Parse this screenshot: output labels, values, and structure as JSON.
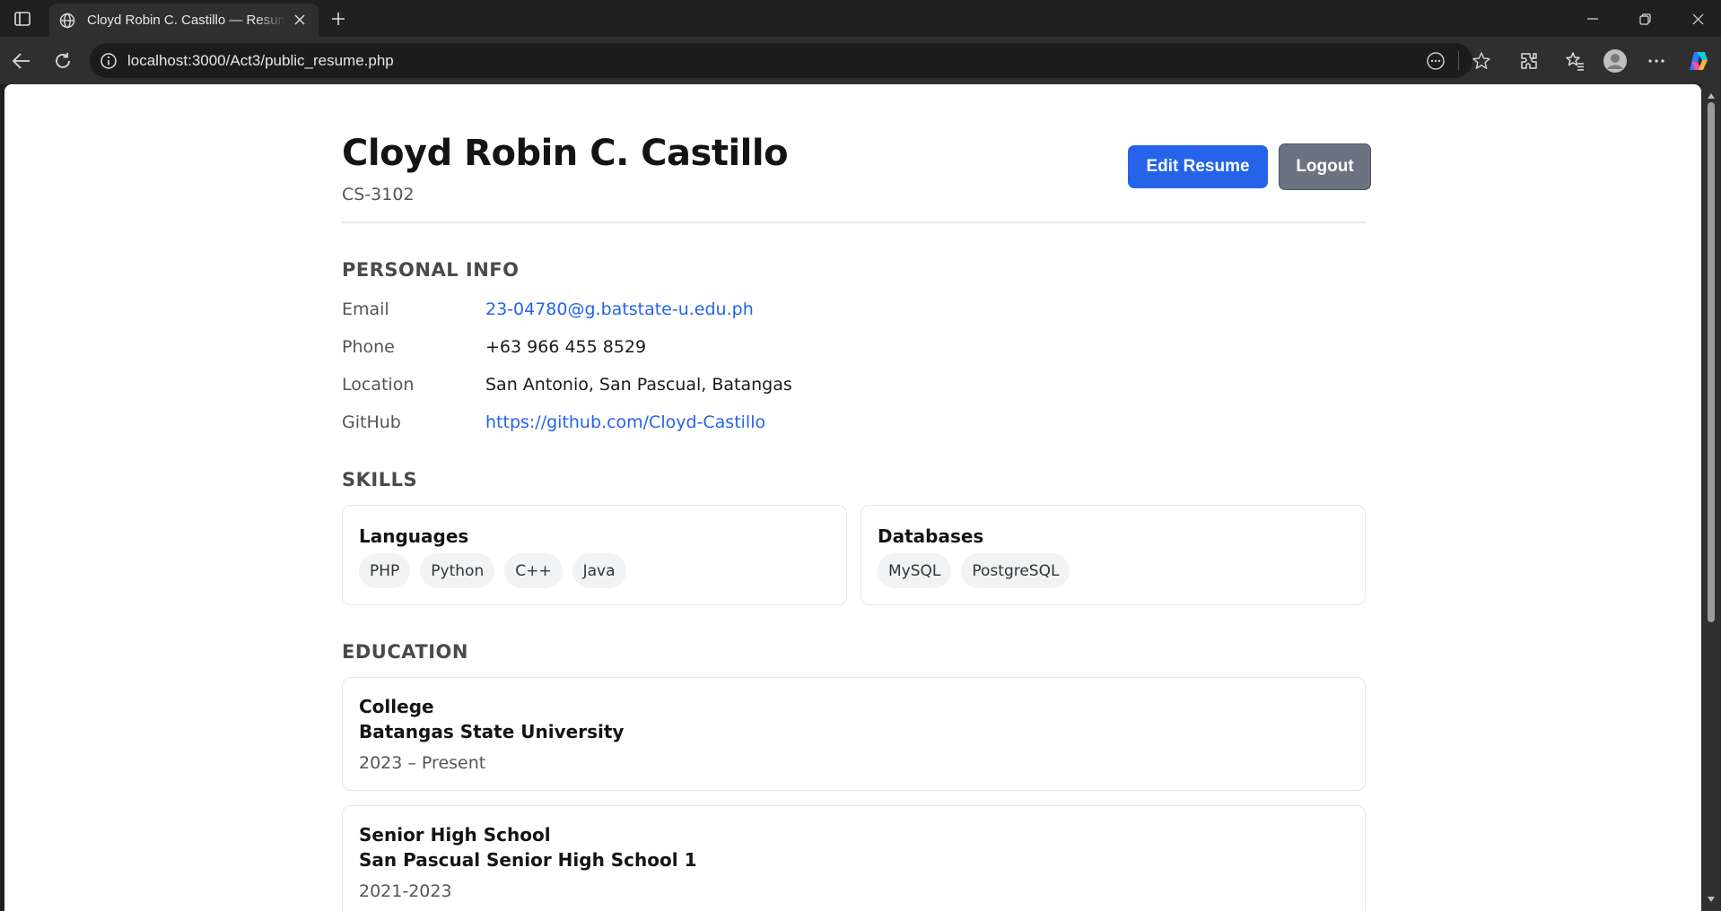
{
  "browser": {
    "tab_title": "Cloyd Robin C. Castillo — Resume",
    "url": "localhost:3000/Act3/public_resume.php"
  },
  "header": {
    "name": "Cloyd Robin C. Castillo",
    "section": "CS-3102",
    "edit_label": "Edit Resume",
    "logout_label": "Logout"
  },
  "personal": {
    "title": "PERSONAL INFO",
    "rows": [
      {
        "label": "Email",
        "value": "23-04780@g.batstate-u.edu.ph"
      },
      {
        "label": "Phone",
        "value": "+63 966 455 8529"
      },
      {
        "label": "Location",
        "value": "San Antonio, San Pascual, Batangas"
      },
      {
        "label": "GitHub",
        "value": "https://github.com/Cloyd-Castillo"
      }
    ]
  },
  "skills": {
    "title": "SKILLS",
    "groups": [
      {
        "name": "Languages",
        "items": [
          "PHP",
          "Python",
          "C++",
          "Java"
        ]
      },
      {
        "name": "Databases",
        "items": [
          "MySQL",
          "PostgreSQL"
        ]
      }
    ]
  },
  "education": {
    "title": "EDUCATION",
    "entries": [
      {
        "level": "College",
        "school": "Batangas State University",
        "years": "2023 – Present"
      },
      {
        "level": "Senior High School",
        "school": "San Pascual Senior High School 1",
        "years": "2021-2023"
      }
    ]
  },
  "colors": {
    "primary": "#2563eb",
    "secondary": "#6b7280",
    "link": "#2563eb"
  }
}
